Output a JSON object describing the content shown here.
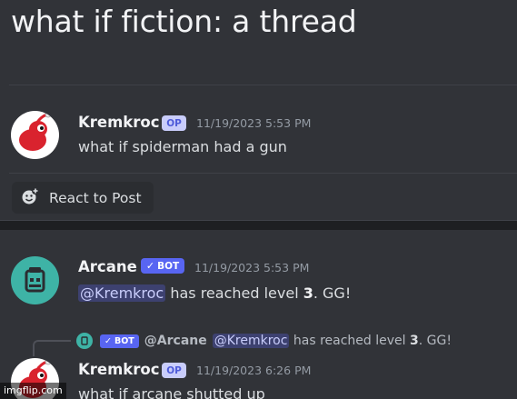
{
  "thread": {
    "title": "what if fiction: a thread"
  },
  "messages": [
    {
      "author": "Kremkroc",
      "tag": "OP",
      "timestamp": "11/19/2023 5:53 PM",
      "content": "what if spiderman had a gun"
    },
    {
      "author": "Arcane",
      "tag": "BOT",
      "timestamp": "11/19/2023 5:53 PM",
      "mention": "@Kremkroc",
      "content_mid": " has reached level ",
      "level": "3",
      "content_end": ". GG!"
    },
    {
      "author": "Kremkroc",
      "tag": "OP",
      "timestamp": "11/19/2023 6:26 PM",
      "content": "what if arcane shutted up",
      "reply": {
        "tag": "BOT",
        "author": "@Arcane",
        "mention": "@Kremkroc",
        "text_mid": " has reached level ",
        "level": "3",
        "text_end": ". GG!"
      }
    }
  ],
  "react_button": {
    "label": "React to Post",
    "icon": "add-reaction-icon"
  },
  "icons": {
    "bot_check": "checkmark-icon"
  },
  "colors": {
    "background": "#313338",
    "blurple": "#5865f2",
    "arcane_teal": "#3eb3a6",
    "pikmin_red": "#d9232e"
  },
  "watermark": "imgflip.com"
}
